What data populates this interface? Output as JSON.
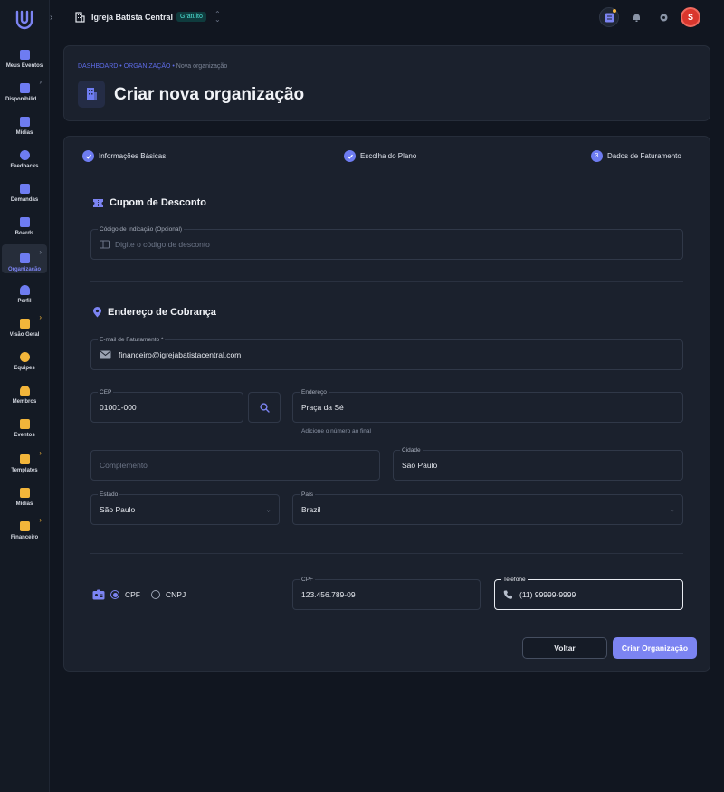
{
  "topbar": {
    "org_name": "Igreja Batista Central",
    "plan_badge": "Gratuito",
    "avatar_initial": "S"
  },
  "sidebar": {
    "items": [
      {
        "label": "Meus Eventos",
        "icon": "calendar-icon",
        "color": "#6e7cf1"
      },
      {
        "label": "Disponibilidade",
        "icon": "calendar-clock-icon",
        "color": "#6e7cf1"
      },
      {
        "label": "Mídias",
        "icon": "media-icon",
        "color": "#6e7cf1"
      },
      {
        "label": "Feedbacks",
        "icon": "chat-icon",
        "color": "#6e7cf1"
      },
      {
        "label": "Demandas",
        "icon": "tasks-icon",
        "color": "#6e7cf1"
      },
      {
        "label": "Boards",
        "icon": "board-icon",
        "color": "#6e7cf1"
      },
      {
        "label": "Organização",
        "icon": "building-icon",
        "color": "#6e7cf1"
      },
      {
        "label": "Perfil",
        "icon": "user-icon",
        "color": "#6e7cf1"
      },
      {
        "label": "Visão Geral",
        "icon": "chart-icon",
        "color": "#f2b53a"
      },
      {
        "label": "Equipes",
        "icon": "team-icon",
        "color": "#f2b53a"
      },
      {
        "label": "Membros",
        "icon": "member-icon",
        "color": "#f2b53a"
      },
      {
        "label": "Eventos",
        "icon": "calendar-icon",
        "color": "#f2b53a"
      },
      {
        "label": "Templates",
        "icon": "clipboard-icon",
        "color": "#f2b53a"
      },
      {
        "label": "Mídias",
        "icon": "media-icon",
        "color": "#f2b53a"
      },
      {
        "label": "Financeiro",
        "icon": "wallet-icon",
        "color": "#f2b53a"
      }
    ]
  },
  "header": {
    "breadcrumb_1": "DASHBOARD",
    "breadcrumb_2": "ORGANIZAÇÃO",
    "breadcrumb_3": "Nova organização",
    "separator": "•",
    "title": "Criar nova organização"
  },
  "steps": [
    {
      "label": "Informações Básicas",
      "status": "done"
    },
    {
      "label": "Escolha do Plano",
      "status": "done"
    },
    {
      "label": "Dados de Faturamento",
      "status": "current",
      "number": "3"
    }
  ],
  "coupon": {
    "title": "Cupom de Desconto",
    "label": "Código de Indicação (Opcional)",
    "placeholder": "Digite o código de desconto"
  },
  "billing": {
    "title": "Endereço de Cobrança",
    "email_label": "E-mail de Faturamento *",
    "email_value": "financeiro@igrejabatistacentral.com",
    "cep_label": "CEP",
    "cep_value": "01001-000",
    "address_label": "Endereço",
    "address_value": "Praça da Sé",
    "address_helper": "Adicione o número ao final",
    "complement_placeholder": "Complemento",
    "city_label": "Cidade",
    "city_value": "São Paulo",
    "state_label": "Estado",
    "state_value": "São Paulo",
    "country_label": "País",
    "country_value": "Brazil"
  },
  "document": {
    "option_cpf": "CPF",
    "option_cnpj": "CNPJ",
    "selected": "CPF",
    "cpf_label": "CPF",
    "cpf_value": "123.456.789-09",
    "phone_label": "Telefone",
    "phone_value": "(11) 99999-9999"
  },
  "actions": {
    "back": "Voltar",
    "submit": "Criar Organização"
  },
  "colors": {
    "accent": "#7c84f2",
    "warning": "#f2b53a",
    "badge": "#4fe0d5",
    "danger": "#d9362d"
  }
}
